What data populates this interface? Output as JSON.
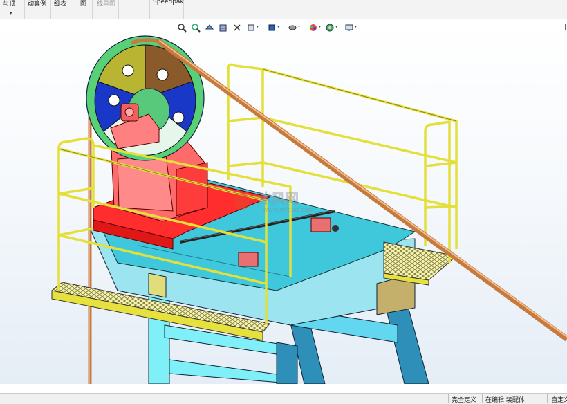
{
  "ribbon": {
    "items": [
      {
        "label": "与顶",
        "enabled": true
      },
      {
        "label": "动算例",
        "enabled": true
      },
      {
        "label": "细表",
        "enabled": true
      },
      {
        "label": "图",
        "enabled": true
      },
      {
        "label": "线草图",
        "enabled": false
      },
      {
        "label": "Speedpak",
        "enabled": true
      }
    ],
    "dropdown_caret": "▾"
  },
  "view_toolbar": {
    "icons": [
      "zoom-to-fit-icon",
      "zoom-to-area-icon",
      "previous-view-icon",
      "section-view-icon",
      "view-orientation-icon",
      "display-style-icon",
      "hide-show-items-icon",
      "edit-appearance-icon",
      "apply-scene-icon",
      "view-settings-icon",
      "monitor-icon"
    ],
    "caret": "▾"
  },
  "watermark": {
    "brand": "沐风网",
    "url": "www.mfcad.com"
  },
  "status": {
    "definition": "完全定义",
    "editing": "在编辑 装配体",
    "custom": "自定义"
  },
  "colors": {
    "railing": "#e3df3b",
    "frame": "#2e8fb8",
    "deck": "#3fc8dc",
    "pink_base": "#ff4a4a",
    "belt": "#d9955b",
    "wheel_rim": "#5bd07a"
  }
}
